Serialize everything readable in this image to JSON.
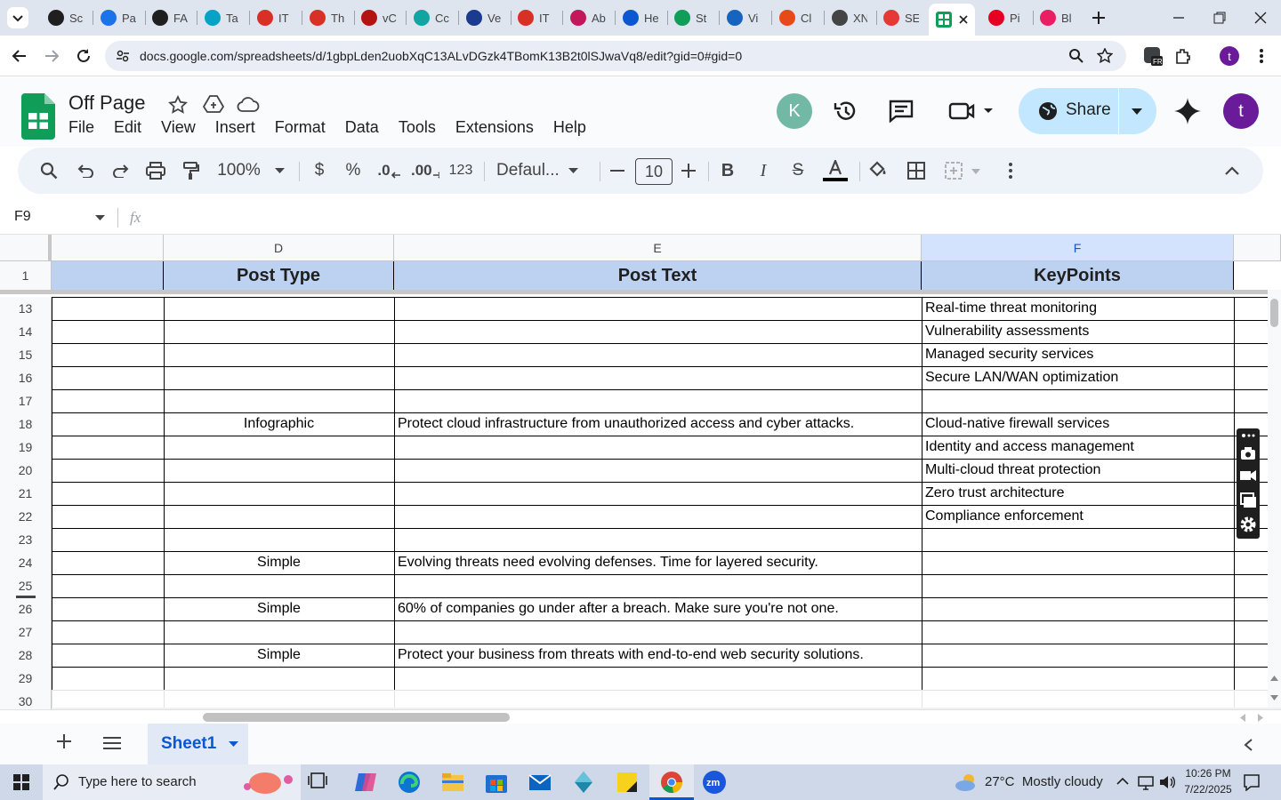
{
  "browser": {
    "tabs": [
      {
        "label": "Sc",
        "color": "#1f1f1f"
      },
      {
        "label": "Pa",
        "color": "#1a73e8"
      },
      {
        "label": "FA",
        "color": "#1f1f1f"
      },
      {
        "label": "Ta",
        "color": "#06a3c7"
      },
      {
        "label": "IT",
        "color": "#d93025"
      },
      {
        "label": "Th",
        "color": "#d93025"
      },
      {
        "label": "vC",
        "color": "#b31412"
      },
      {
        "label": "Cc",
        "color": "#12a4a0"
      },
      {
        "label": "Ve",
        "color": "#1a3b8f"
      },
      {
        "label": "IT",
        "color": "#d93025"
      },
      {
        "label": "Ab",
        "color": "#c2185b"
      },
      {
        "label": "He",
        "color": "#0b57d0"
      },
      {
        "label": "St",
        "color": "#0f9d58"
      },
      {
        "label": "Vi",
        "color": "#1565c0"
      },
      {
        "label": "Cl",
        "color": "#e64a19"
      },
      {
        "label": "XN",
        "color": "#444444"
      },
      {
        "label": "SE",
        "color": "#e53935"
      },
      {
        "label": "",
        "color": "#0f9d58"
      },
      {
        "label": "Pi",
        "color": "#e60023"
      },
      {
        "label": "Bl",
        "color": "#e91e63"
      }
    ],
    "url": "docs.google.com/spreadsheets/d/1gbpLden2uobXqC13ALvDGzk4TBomK13B2t0lSJwaVq8/edit?gid=0#gid=0"
  },
  "doc": {
    "title": "Off Page",
    "menus": [
      "File",
      "Edit",
      "View",
      "Insert",
      "Format",
      "Data",
      "Tools",
      "Extensions",
      "Help"
    ],
    "avatar_letter": "K",
    "share_label": "Share",
    "account_letter": "t"
  },
  "toolbar": {
    "zoom": "100%",
    "currency": "$",
    "percent": "%",
    "dec_less": ".0",
    "dec_more": ".00",
    "format_123": "123",
    "font": "Defaul...",
    "font_size": "10"
  },
  "formula": {
    "cell_ref": "F9",
    "fx": "fx",
    "value": ""
  },
  "sheet": {
    "columns": [
      "D",
      "E",
      "F"
    ],
    "header_row_number": "1",
    "headers": {
      "D": "Post Type",
      "E": "Post Text",
      "F": "KeyPoints"
    },
    "rows": [
      {
        "n": "13",
        "D": "",
        "E": "",
        "F": "Real-time threat monitoring"
      },
      {
        "n": "14",
        "D": "",
        "E": "",
        "F": "Vulnerability assessments"
      },
      {
        "n": "15",
        "D": "",
        "E": "",
        "F": "Managed security services"
      },
      {
        "n": "16",
        "D": "",
        "E": "",
        "F": "Secure LAN/WAN optimization"
      },
      {
        "n": "17",
        "D": "",
        "E": "",
        "F": ""
      },
      {
        "n": "18",
        "D": "Infographic",
        "E": "Protect cloud infrastructure from unauthorized access and cyber attacks.",
        "F": "Cloud-native firewall services"
      },
      {
        "n": "19",
        "D": "",
        "E": "",
        "F": "Identity and access management"
      },
      {
        "n": "20",
        "D": "",
        "E": "",
        "F": "Multi-cloud threat protection"
      },
      {
        "n": "21",
        "D": "",
        "E": "",
        "F": "Zero trust architecture"
      },
      {
        "n": "22",
        "D": "",
        "E": "",
        "F": "Compliance enforcement"
      },
      {
        "n": "23",
        "D": "",
        "E": "",
        "F": ""
      },
      {
        "n": "24",
        "D": "Simple",
        "E": "Evolving threats need evolving defenses. Time for layered security.",
        "F": ""
      },
      {
        "n": "25",
        "D": "",
        "E": "",
        "F": ""
      },
      {
        "n": "26",
        "D": "Simple",
        "E": "60% of companies go under after a breach. Make sure you're not one.",
        "F": ""
      },
      {
        "n": "27",
        "D": "",
        "E": "",
        "F": ""
      },
      {
        "n": "28",
        "D": "Simple",
        "E": "Protect your business from threats with end-to-end web security solutions.",
        "F": ""
      },
      {
        "n": "29",
        "D": "",
        "E": "",
        "F": ""
      },
      {
        "n": "30",
        "D": "",
        "E": "",
        "F": ""
      }
    ],
    "tab_name": "Sheet1"
  },
  "taskbar": {
    "search_placeholder": "Type here to search",
    "weather": "27°C  Mostly cloudy",
    "time": "10:26 PM",
    "date": "7/22/2025"
  },
  "colors": {
    "accent": "#0b57d0",
    "header_fill": "#bdd2f1",
    "share_bg": "#c2e7ff",
    "sheets_green": "#0f9d58"
  }
}
